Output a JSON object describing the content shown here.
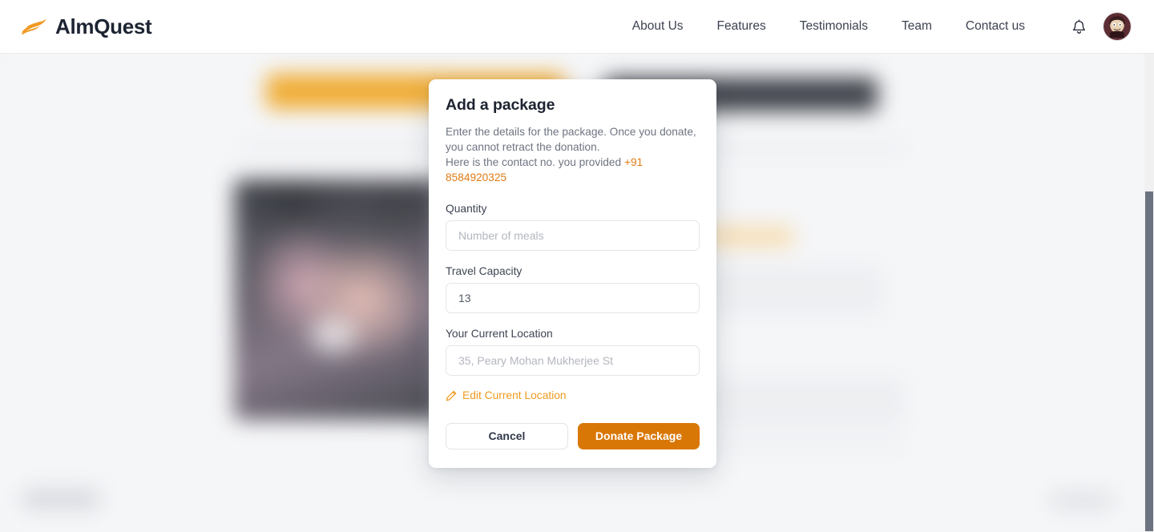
{
  "header": {
    "brand": {
      "name": "AlmQuest",
      "logo_icon": "wing-logo-icon",
      "logo_color": "#ef9a23"
    },
    "nav_items": [
      {
        "label": "About Us"
      },
      {
        "label": "Features"
      },
      {
        "label": "Testimonials"
      },
      {
        "label": "Team"
      },
      {
        "label": "Contact us"
      }
    ],
    "actions": {
      "notifications_icon": "bell-icon",
      "avatar_icon": "user-avatar"
    }
  },
  "modal": {
    "title": "Add a package",
    "description_line_1": "Enter the details for the package. Once you donate,",
    "description_line_2": "you cannot retract the donation.",
    "description_line_3": "Here is the contact no. you provided",
    "contact_number": "+91 8584920325",
    "fields": [
      {
        "label": "Quantity",
        "name": "quantity",
        "value": "",
        "placeholder": "Number of meals"
      },
      {
        "label": "Travel Capacity",
        "name": "travel-capacity",
        "value": "13",
        "placeholder": ""
      },
      {
        "label": "Your Current Location",
        "name": "current-location",
        "value": "",
        "placeholder": "35, Peary Mohan Mukherjee St"
      }
    ],
    "edit_location_link": {
      "label": "Edit Current Location",
      "icon": "pencil-icon"
    },
    "buttons": {
      "cancel": "Cancel",
      "donate": "Donate Package"
    }
  },
  "colors": {
    "brand_orange": "#ef9a23",
    "accent_orange": "#ed9b1f",
    "primary_button": "#d97706",
    "contact_link": "#e07b16",
    "text_dark": "#1d2330",
    "text_muted": "#6e7481",
    "page_background": "#f4f5f7"
  }
}
